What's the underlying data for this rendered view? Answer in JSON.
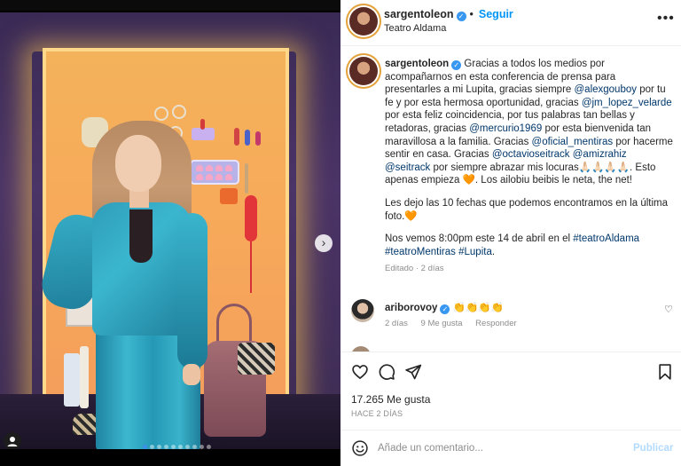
{
  "post": {
    "username": "sargentoleon",
    "follow_label": "Seguir",
    "separator": "•",
    "location": "Teatro Aldama",
    "more_label": "•••",
    "verified_mark": "✓"
  },
  "caption": {
    "username": "sargentoleon",
    "p1_a": "Gracias a todos los medios por acompañarnos en esta conferencia de prensa para presentarles a mi Lupita, gracias siempre",
    "tag_alexgouboy": "@alexgouboy",
    "p1_b": "por tu fe y por esta hermosa oportunidad, gracias",
    "tag_jm": "@jm_lopez_velarde",
    "p1_c": "por esta feliz coincidencia, por tus palabras tan bellas y retadoras, gracias",
    "tag_mercurio": "@mercurio1969",
    "p1_d": "por esta bienvenida tan maravillosa a la familia. Gracias",
    "tag_oficial": "@oficial_mentiras",
    "p1_e": "por hacerme sentir en casa. Gracias",
    "tag_octavio": "@octavioseitrack",
    "tag_amiz": "@amizrahiz",
    "tag_seitrack": "@seitrack",
    "p1_f": "por siempre abrazar mis locuras🙏🏻🙏🏻🙏🏻🙏🏻. Esto apenas empieza 🧡. Los ailobiu beibis le neta, the net!",
    "p2": "Les dejo las 10 fechas que podemos encontramos en la última foto.🧡",
    "p3_a": "Nos vemos 8:00pm este 14 de abril en el",
    "tag_teatroaldama": "#teatroAldama",
    "tag_teatromentiras": "#teatroMentiras",
    "tag_lupita": "#Lupita",
    "p3_end": ".",
    "edited": "Editado · 2 días"
  },
  "comment": {
    "username": "ariborovoy",
    "text": "👏👏👏👏",
    "time": "2 días",
    "likes": "9 Me gusta",
    "reply": "Responder",
    "heart": "♡"
  },
  "next_comment_text": "…",
  "stats": {
    "likes": "17.265 Me gusta",
    "ago": "HACE 2 DÍAS"
  },
  "composer": {
    "placeholder": "Añade un comentario...",
    "publish": "Publicar"
  },
  "media": {
    "carousel_count": 10,
    "active_index": 0,
    "next_glyph": "›",
    "user_tag_glyph": "●"
  },
  "colors": {
    "accent": "#0095f6",
    "link": "#00376b",
    "verified": "#3897f0",
    "muted": "#8e8e8e"
  }
}
